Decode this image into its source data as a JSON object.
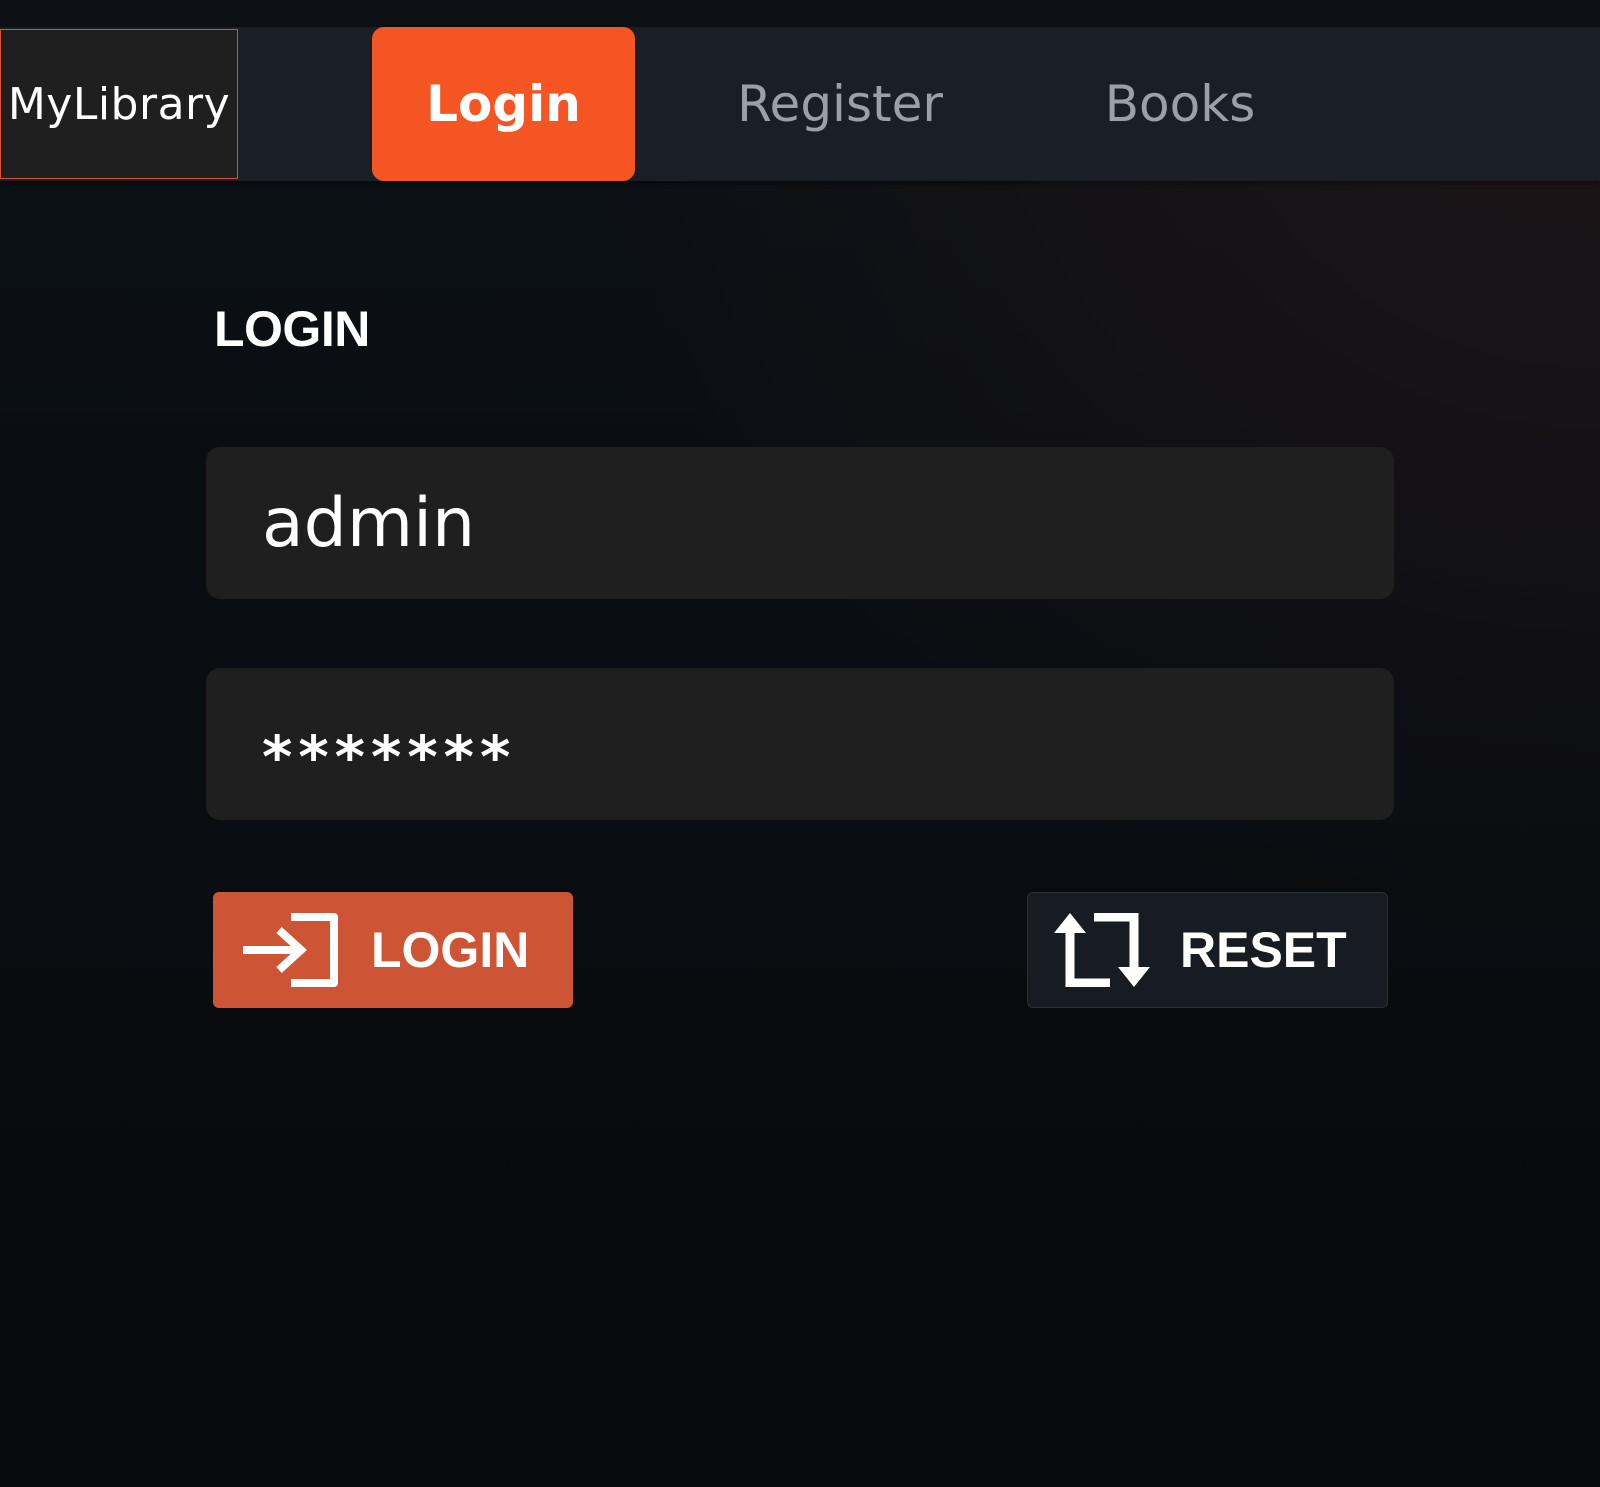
{
  "nav": {
    "brand": "MyLibrary",
    "tabs": [
      {
        "label": "Login",
        "active": true
      },
      {
        "label": "Register",
        "active": false
      },
      {
        "label": "Books",
        "active": false
      }
    ]
  },
  "form": {
    "title": "LOGIN",
    "username_value": "admin",
    "password_display": "*******",
    "login_button_label": "LOGIN",
    "reset_button_label": "RESET",
    "login_icon": "sign-in-icon",
    "reset_icon": "retweet-icon"
  },
  "colors": {
    "accent": "#f55523",
    "login_button": "#cd5535",
    "navbar": "#1a1f26",
    "input_bg": "#1f1f20",
    "reset_button": "#171c22"
  }
}
